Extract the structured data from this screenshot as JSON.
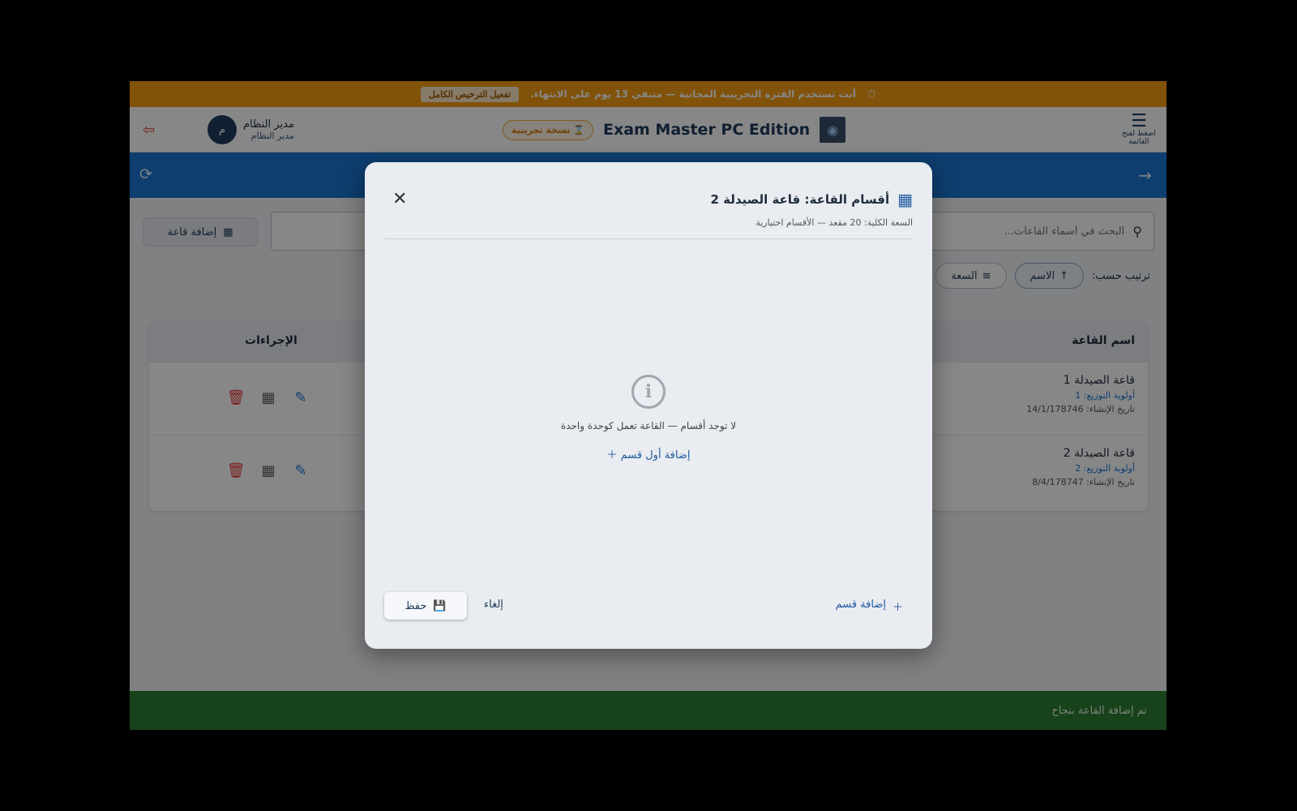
{
  "trial_bar": {
    "message": "أنت تستخدم الفترة التجريبية المجانية — متبقي 13 يوم على الانتهاء.",
    "activate_label": "تفعيل الترخيص الكامل"
  },
  "header": {
    "menu_hint": "اضغط لفتح القائمة",
    "app_title": "Exam Master PC Edition",
    "trial_chip": "نسخة تجريبية",
    "user_name": "مدير النظام",
    "user_role": "مدير النظام",
    "avatar_letter": "م"
  },
  "actions": {
    "add_hall_label": "إضافة قاعة",
    "search_placeholder": "البحث في أسماء القاعات..."
  },
  "sort": {
    "label": "ترتيب حسب:",
    "options": [
      "الاسم",
      "السعة"
    ]
  },
  "table": {
    "columns": {
      "name": "اسم القاعة",
      "actions": "الإجراءات"
    },
    "rows": [
      {
        "name": "قاعة الصيدلة 1",
        "priority": "أولوية التوزيع: 1",
        "created": "تاريخ الإنشاء: 14/1/178746"
      },
      {
        "name": "قاعة الصيدلة 2",
        "priority": "أولوية التوزيع: 2",
        "created": "تاريخ الإنشاء: 8/4/178747"
      }
    ]
  },
  "snackbar": {
    "message": "تم إضافة القاعة بنجاح"
  },
  "dialog": {
    "title": "أقسام القاعة: قاعة الصيدلة 2",
    "subtitle": "السعة الكلية: 20 مقعد — الأقسام اختيارية",
    "empty_text": "لا توجد أقسام — القاعة تعمل كوحدة واحدة",
    "add_first_label": "إضافة أول قسم",
    "add_section_label": "إضافة قسم",
    "cancel_label": "إلغاء",
    "save_label": "حفظ"
  },
  "colors": {
    "trial_bar": "#f39c12",
    "toolbar": "#1976d2",
    "snackbar": "#2e7d32",
    "delete": "#e53935"
  }
}
